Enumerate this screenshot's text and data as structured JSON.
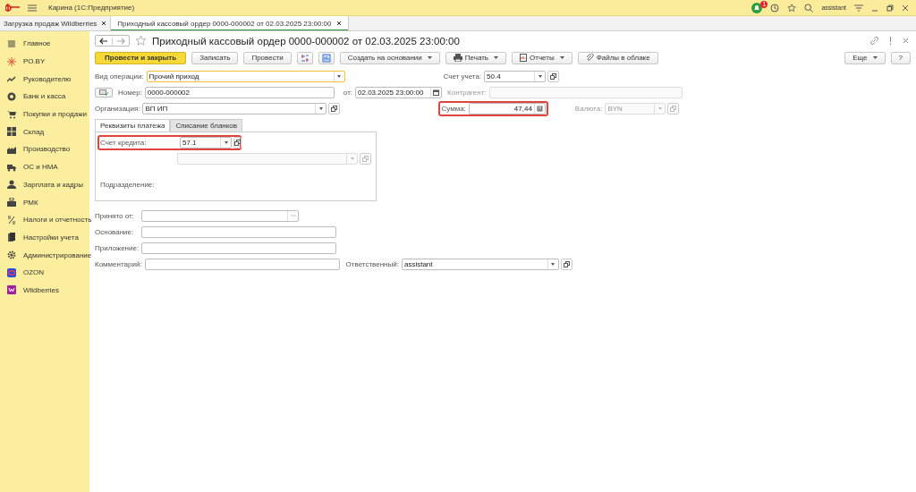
{
  "app": {
    "title": "Карина  (1С:Предприятие)",
    "notifications": "1",
    "user": "assistant"
  },
  "open_tabs": [
    {
      "label": "Загрузка продаж Wildberries",
      "selected": false
    },
    {
      "label": "Приходный кассовый ордер 0000-000002 от 02.03.2025 23:00:00",
      "selected": true
    }
  ],
  "sidebar": {
    "items": [
      {
        "label": "Главное"
      },
      {
        "label": "РО.BY"
      },
      {
        "label": "Руководителю"
      },
      {
        "label": "Банк и касса"
      },
      {
        "label": "Покупки и продажи"
      },
      {
        "label": "Склад"
      },
      {
        "label": "Производство"
      },
      {
        "label": "ОС и НМА"
      },
      {
        "label": "Зарплата и кадры"
      },
      {
        "label": "РМК"
      },
      {
        "label": "Налоги и отчетность"
      },
      {
        "label": "Настройки учета"
      },
      {
        "label": "Администрирование"
      },
      {
        "label": "OZON"
      },
      {
        "label": "Wildberries"
      }
    ]
  },
  "document": {
    "title": "Приходный кассовый ордер 0000-000002 от 02.03.2025 23:00:00",
    "favorite": false,
    "toolbar": {
      "post_and_close": "Провести и закрыть",
      "save": "Записать",
      "post": "Провести",
      "create_based_on": "Создать на основании",
      "print": "Печать",
      "reports": "Отчеты",
      "cloud_files": "Файлы в облаке",
      "more": "Еще",
      "help": "?"
    },
    "operation_type": {
      "label": "Вид операции:",
      "value": "Прочий приход",
      "focused": true
    },
    "account": {
      "label": "Счет учета:",
      "value": "50.4"
    },
    "number": {
      "label": "Номер:",
      "value": "0000-000002"
    },
    "date": {
      "label": "от:",
      "value": "02.03.2025 23:00:00"
    },
    "counterparty": {
      "label": "Контрагент:",
      "disabled": true
    },
    "organization": {
      "label": "Организация:",
      "value": "ВП ИП"
    },
    "amount": {
      "label": "Сумма:",
      "value": "47,44",
      "highlighted": true
    },
    "currency": {
      "label": "Валюта:",
      "value": "BYN",
      "disabled": true
    },
    "inner_tabs": [
      {
        "label": "Реквизиты платежа",
        "selected": true
      },
      {
        "label": "Списание бланков",
        "selected": false
      }
    ],
    "credit_account": {
      "label": "Счет кредита:",
      "value": "57.1",
      "highlighted": true
    },
    "subdivision": {
      "label": "Подразделение:"
    },
    "received_from": {
      "label": "Принято от:"
    },
    "basis": {
      "label": "Основание:"
    },
    "attachment": {
      "label": "Приложение:"
    },
    "comment": {
      "label": "Комментарий:"
    },
    "responsible": {
      "label": "Ответственный:",
      "value": "assistant"
    }
  }
}
